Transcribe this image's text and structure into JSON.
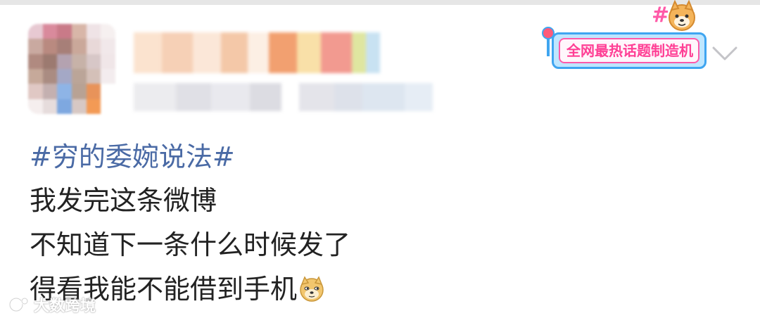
{
  "post": {
    "hashtag": "#穷的委婉说法#",
    "lines": [
      "我发完这条微博",
      "不知道下一条什么时候发了",
      "得看我能不能借到手机"
    ]
  },
  "badge": {
    "label": "全网最热话题制造机",
    "hash_symbol": "#"
  },
  "watermark": {
    "text": "大数跨境"
  },
  "icons": [
    "avatar-blurred",
    "dog-mascot-icon",
    "chevron-down-icon",
    "doge-emoji-icon"
  ],
  "colors": {
    "hashtag": "#4a6aa5",
    "body_text": "#222222",
    "badge_pink": "#ff3f95",
    "badge_blue": "#3fa5f0"
  }
}
